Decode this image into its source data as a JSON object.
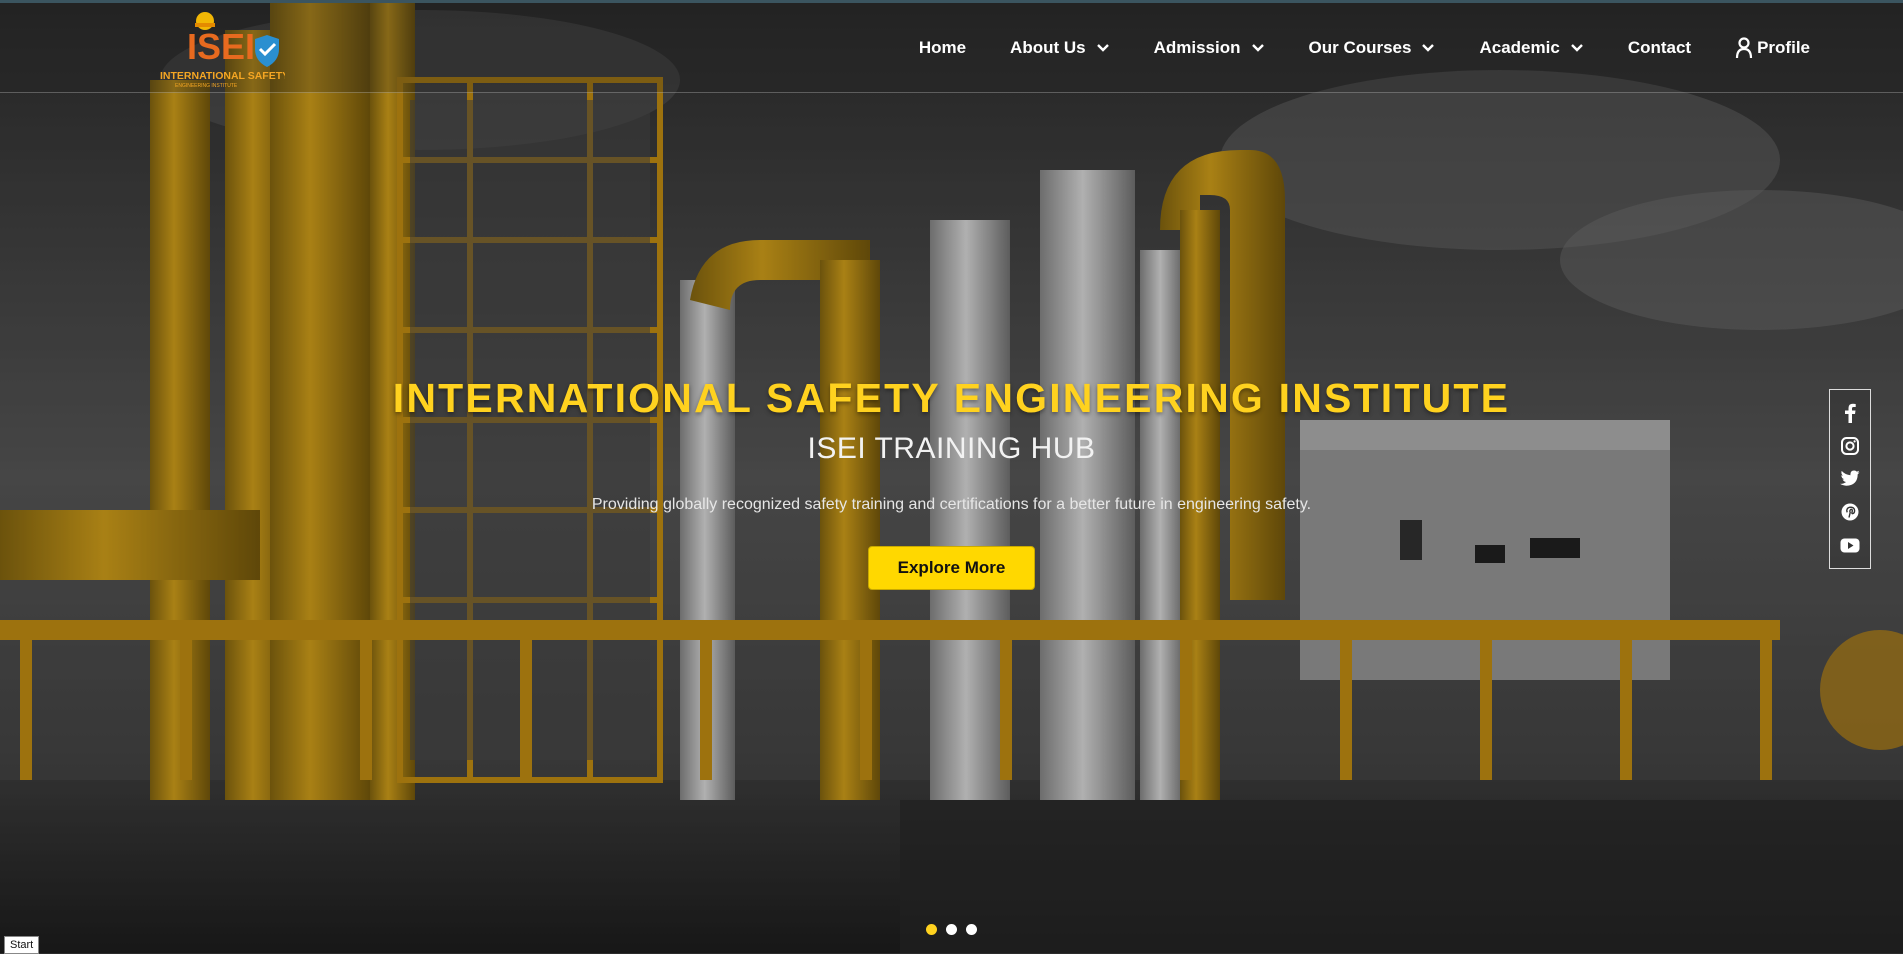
{
  "brand": {
    "logo_letters": "ISEI",
    "logo_caption": "INTERNATIONAL SAFETY",
    "logo_subcaption": "ENGINEERING INSTITUTE"
  },
  "nav": {
    "items": [
      {
        "label": "Home",
        "dropdown": false
      },
      {
        "label": "About Us",
        "dropdown": true
      },
      {
        "label": "Admission",
        "dropdown": true
      },
      {
        "label": "Our Courses",
        "dropdown": true
      },
      {
        "label": "Academic",
        "dropdown": true
      },
      {
        "label": "Contact",
        "dropdown": false
      }
    ],
    "profile_label": "Profile"
  },
  "hero": {
    "title": "INTERNATIONAL SAFETY ENGINEERING INSTITUTE",
    "subtitle": "ISEI TRAINING HUB",
    "description": "Providing globally recognized safety training and certifications for a better future in engineering safety.",
    "cta_label": "Explore More"
  },
  "social": [
    "facebook-icon",
    "instagram-icon",
    "twitter-icon",
    "pinterest-icon",
    "youtube-icon"
  ],
  "carousel": {
    "slides": 3,
    "active": 1
  },
  "colors": {
    "accent": "#ffd21f",
    "button": "#ffd800",
    "pipe": "#d4a017"
  },
  "footer_tag": "Start"
}
